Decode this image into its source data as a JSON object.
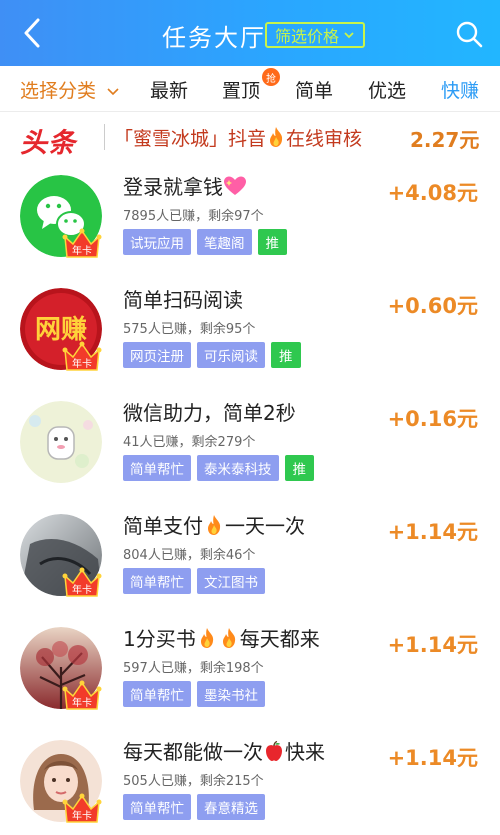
{
  "header": {
    "title": "任务大厅",
    "filter_label": "筛选价格"
  },
  "tabs": [
    {
      "label": "选择分类"
    },
    {
      "label": "最新"
    },
    {
      "label": "置顶",
      "badge": "抢"
    },
    {
      "label": "简单"
    },
    {
      "label": "优选"
    },
    {
      "label": "快赚"
    }
  ],
  "headline": {
    "tag": "头条",
    "text": "「蜜雪冰城」抖音",
    "text2": "在线审核",
    "amount": "2.27元"
  },
  "colors": {
    "header_gradient_start": "#3f8ff5",
    "header_gradient_end": "#22b6ff",
    "accent_orange": "#ec8a26",
    "chip_blue": "#8e9ef0",
    "chip_green": "#2fc84f",
    "headline_red": "#e5272d"
  },
  "tasks": [
    {
      "title": "登录就拿钱",
      "title_suffix": "",
      "meta": "7895人已赚，剩余97个",
      "tags": [
        "试玩应用",
        "笔趣阁"
      ],
      "recommend": "推",
      "reward": "+4.08元",
      "crown_text": "年卡",
      "icon": "wechat-icon"
    },
    {
      "title": "简单扫码阅读",
      "title_suffix": "",
      "meta": "575人已赚，剩余95个",
      "tags": [
        "网页注册",
        "可乐阅读"
      ],
      "recommend": "推",
      "reward": "+0.60元",
      "crown_text": "年卡",
      "icon": "wangzhuan-logo",
      "logo_text": "网赚"
    },
    {
      "title": "微信助力，简单2秒",
      "title_suffix": "",
      "meta": "41人已赚，剩余279个",
      "tags": [
        "简单帮忙",
        "泰米泰科技"
      ],
      "recommend": "推",
      "reward": "+0.16元",
      "crown_text": "",
      "icon": "cartoon-avatar"
    },
    {
      "title": "简单支付",
      "title_suffix": "一天一次",
      "meta": "804人已赚，剩余46个",
      "tags": [
        "简单帮忙",
        "文江图书"
      ],
      "recommend": "",
      "reward": "+1.14元",
      "crown_text": "年卡",
      "icon": "portrait-avatar"
    },
    {
      "title": "1分买书",
      "title_suffix": "每天都来",
      "meta": "597人已赚，剩余198个",
      "tags": [
        "简单帮忙",
        "墨染书社"
      ],
      "recommend": "",
      "reward": "+1.14元",
      "crown_text": "年卡",
      "icon": "tree-avatar"
    },
    {
      "title": "每天都能做一次",
      "title_suffix": "快来",
      "meta": "505人已赚，剩余215个",
      "tags": [
        "简单帮忙",
        "春意精选"
      ],
      "recommend": "",
      "reward": "+1.14元",
      "crown_text": "年卡",
      "icon": "girl-avatar"
    }
  ]
}
